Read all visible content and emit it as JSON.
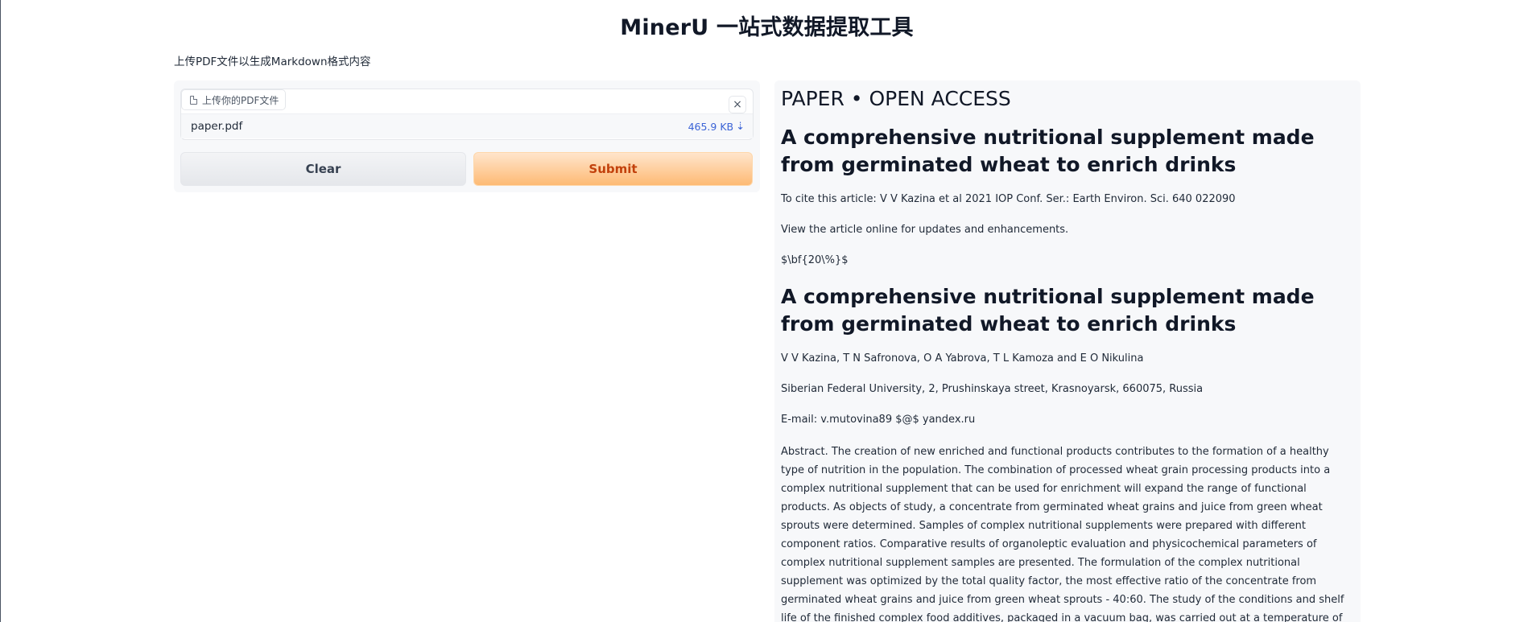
{
  "app": {
    "title": "MinerU 一站式数据提取工具",
    "subtitle": "上传PDF文件以生成Markdown格式内容"
  },
  "upload": {
    "label": "上传你的PDF文件",
    "file_name": "paper.pdf",
    "file_size": "465.9 KB",
    "close_icon": "close-icon",
    "download_icon": "download-icon"
  },
  "buttons": {
    "clear_label": "Clear",
    "submit_label": "Submit"
  },
  "colors": {
    "submit_text": "#c2410c",
    "submit_bg": "#fdba74",
    "clear_bg": "#e5e7eb",
    "file_size": "#3b63d6",
    "panel_bg": "#f7f8fa"
  },
  "output": {
    "heading1": "PAPER • OPEN ACCESS",
    "title1": "A comprehensive nutritional supplement made from germinated wheat to enrich drinks",
    "cite": "To cite this article: V V Kazina et al 2021 IOP Conf. Ser.: Earth Environ. Sci. 640 022090",
    "view": "View the article online for updates and enhancements.",
    "formula": "$\\bf{20\\%}$",
    "title2": "A comprehensive nutritional supplement made from germinated wheat to enrich drinks",
    "authors": "V V Kazina, T N Safronova, O A Yabrova, T L Kamoza and E O Nikulina",
    "affiliation": "Siberian Federal University, 2, Prushinskaya street, Krasnoyarsk, 660075, Russia",
    "email": "E-mail: v.mutovina89 $@$ yandex.ru",
    "abstract": "Abstract. The creation of new enriched and functional products contributes to the formation of a healthy type of nutrition in the population. The combination of processed wheat grain processing products into a complex nutritional supplement that can be used for enrichment will expand the range of functional products. As objects of study, a concentrate from germinated wheat grains and juice from green wheat sprouts were determined. Samples of complex nutritional supplements were prepared with different component ratios. Comparative results of organoleptic evaluation and physicochemical parameters of complex nutritional supplement samples are presented. The formulation of the complex nutritional supplement was optimized by the total quality factor, the most effective ratio of the concentrate from germinated wheat grains and juice from green wheat sprouts - 40:60. The study of the conditions and shelf life of the finished complex food additives, packaged in a vacuum bag, was carried out at a temperature of"
  }
}
